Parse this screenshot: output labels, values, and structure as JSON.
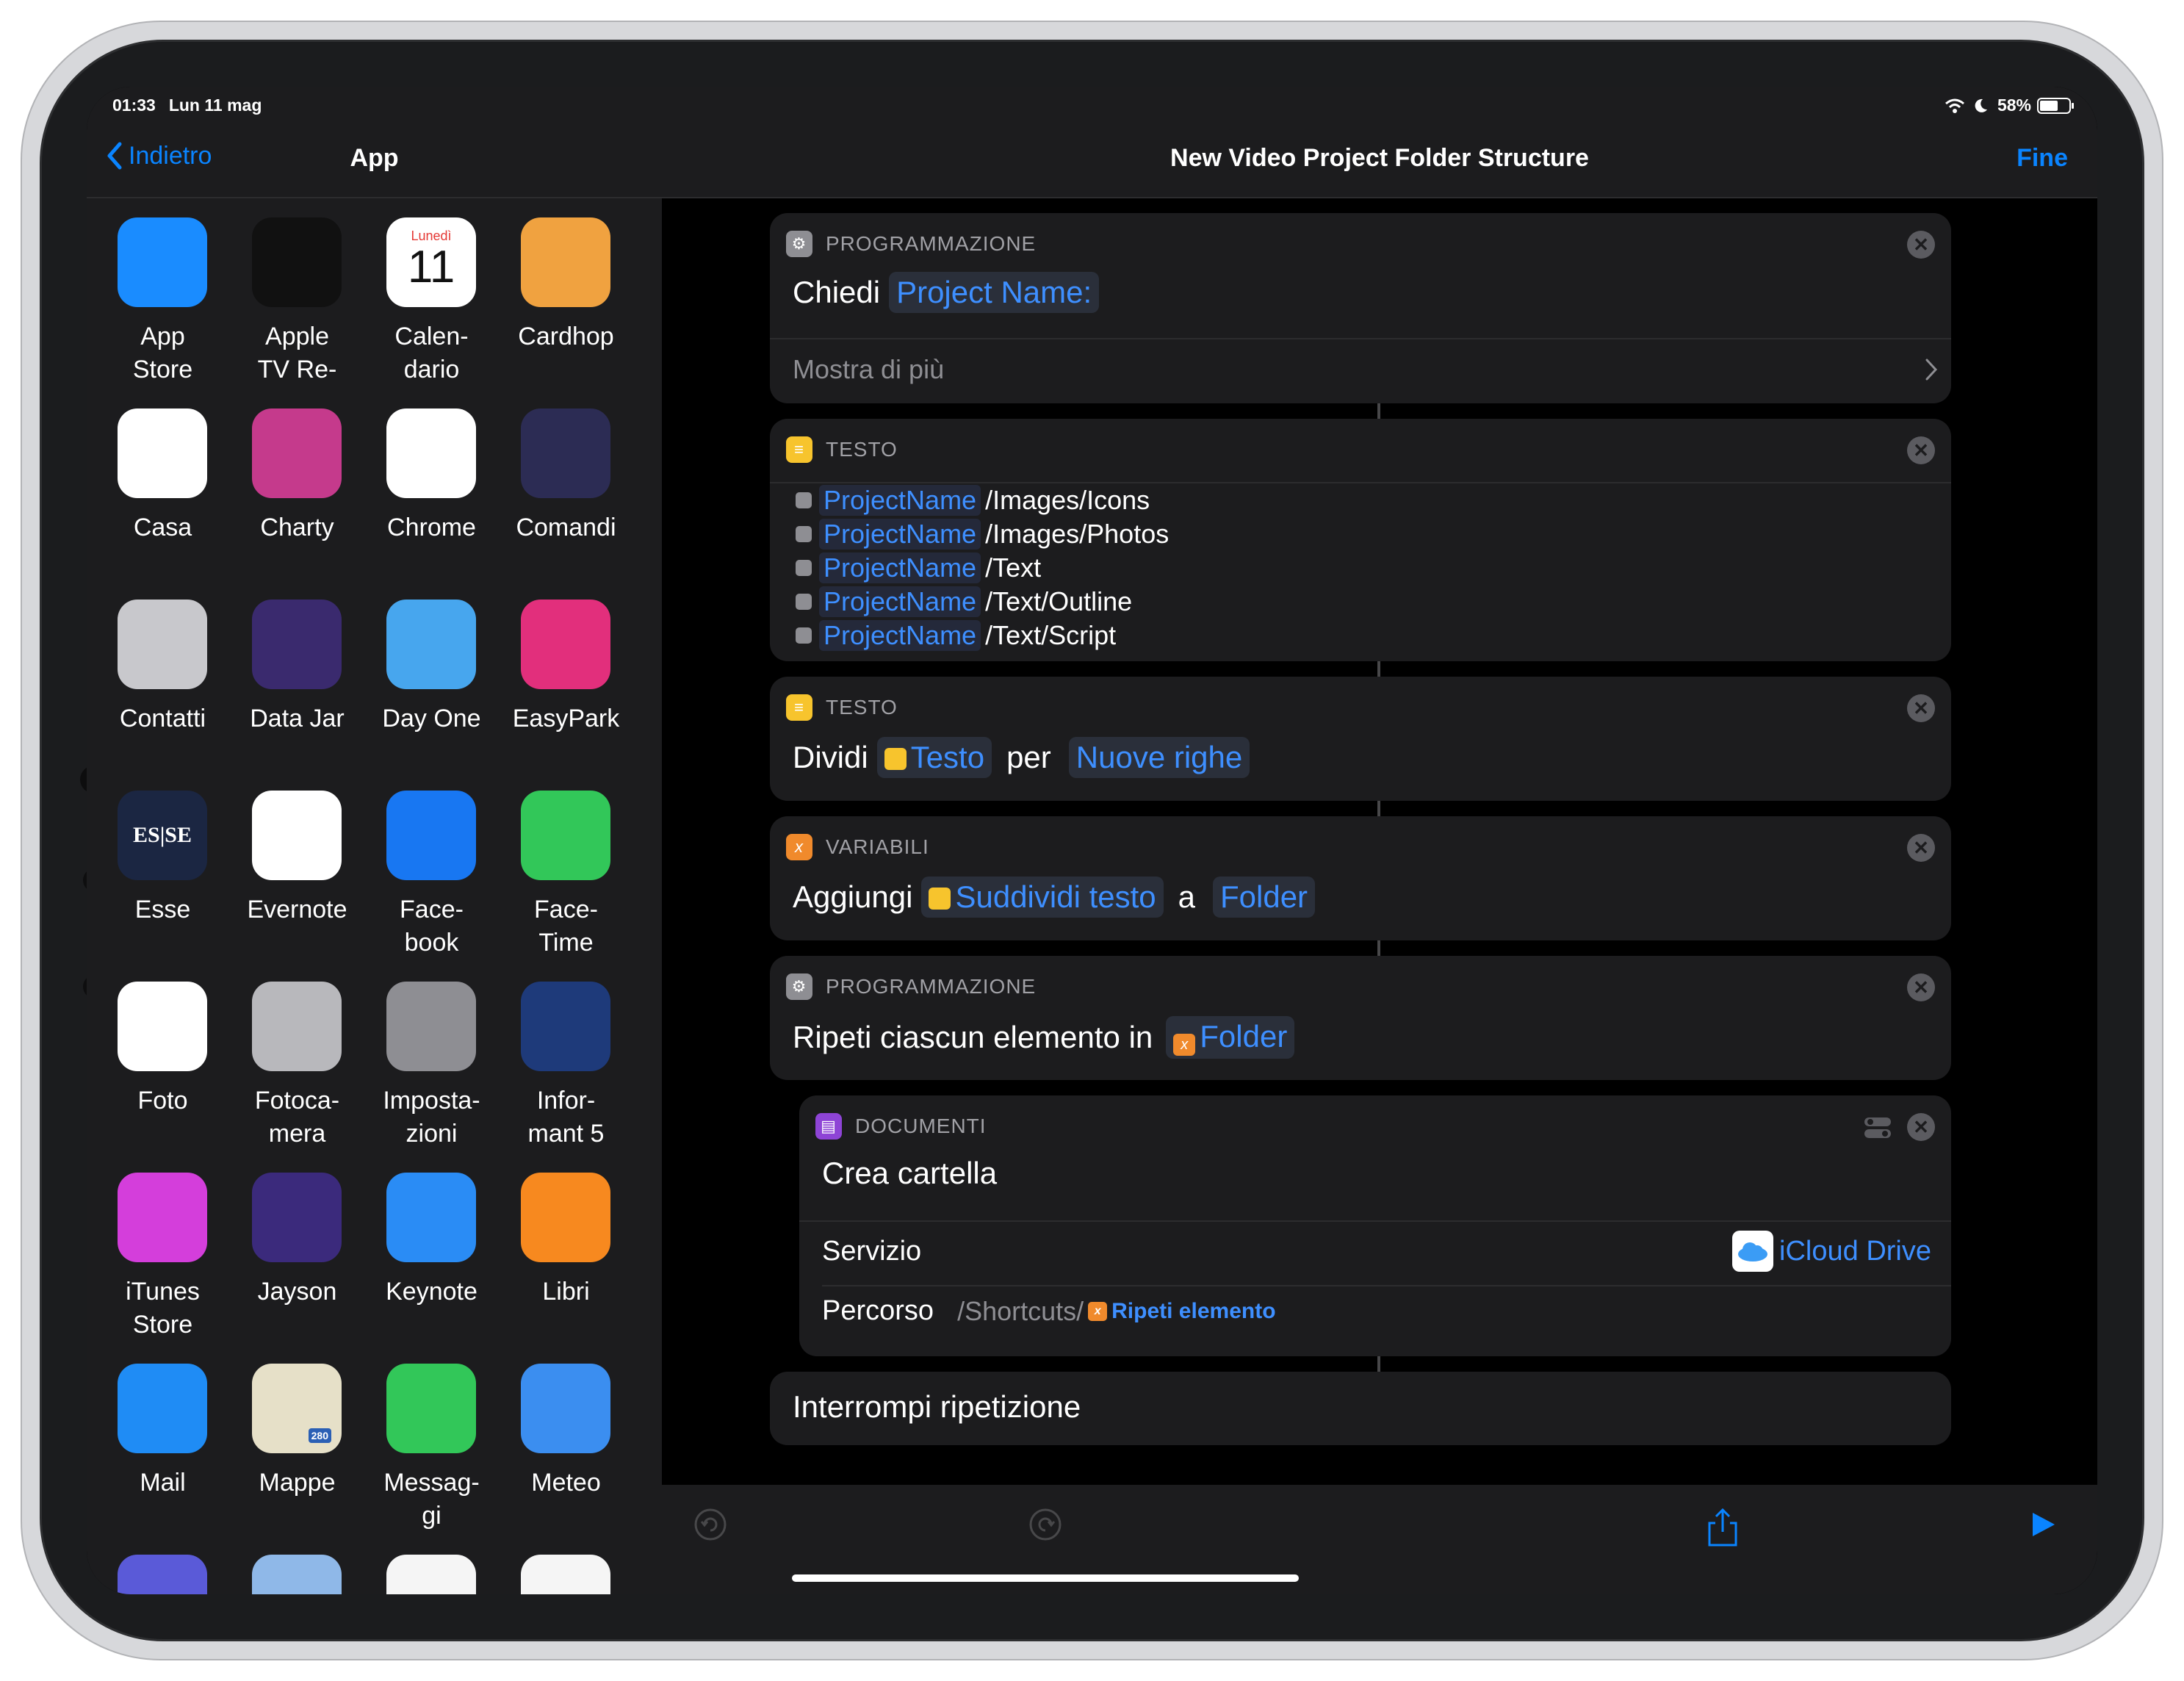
{
  "status": {
    "time": "01:33",
    "date": "Lun 11 mag",
    "battery": "58%"
  },
  "sidebar": {
    "back_label": "Indietro",
    "title": "App",
    "apps": [
      {
        "label": "App\nStore",
        "icon": "app-store-icon",
        "color": "#1a8cff"
      },
      {
        "label": "Apple\nTV Re-",
        "icon": "apple-tv-remote-icon",
        "color": "#111"
      },
      {
        "label": "Calen-\ndario",
        "icon": "calendar-icon",
        "color": "#fff",
        "day": "Lunedì",
        "num": "11"
      },
      {
        "label": "Cardhop",
        "icon": "cardhop-icon",
        "color": "#f0a240"
      },
      {
        "label": "Casa",
        "icon": "home-icon",
        "color": "#fff"
      },
      {
        "label": "Charty",
        "icon": "charty-icon",
        "color": "#c53a8c"
      },
      {
        "label": "Chrome",
        "icon": "chrome-icon",
        "color": "#fff"
      },
      {
        "label": "Comandi",
        "icon": "shortcuts-icon",
        "color": "#2c2c54"
      },
      {
        "label": "Contatti",
        "icon": "contacts-icon",
        "color": "#c8c8cc"
      },
      {
        "label": "Data Jar",
        "icon": "data-jar-icon",
        "color": "#3a2a6e"
      },
      {
        "label": "Day One",
        "icon": "day-one-icon",
        "color": "#47a6ee"
      },
      {
        "label": "EasyPark",
        "icon": "easypark-icon",
        "color": "#e22f7c"
      },
      {
        "label": "Esse",
        "icon": "esse-icon",
        "color": "#1b2642",
        "text": "ES|SE"
      },
      {
        "label": "Evernote",
        "icon": "evernote-icon",
        "color": "#fff"
      },
      {
        "label": "Face-\nbook",
        "icon": "facebook-icon",
        "color": "#1877f2"
      },
      {
        "label": "Face-\nTime",
        "icon": "facetime-icon",
        "color": "#32c759"
      },
      {
        "label": "Foto",
        "icon": "photos-icon",
        "color": "#fff"
      },
      {
        "label": "Fotoca-\nmera",
        "icon": "camera-icon",
        "color": "#b8b8bc"
      },
      {
        "label": "Imposta-\nzioni",
        "icon": "settings-icon",
        "color": "#8e8e93"
      },
      {
        "label": "Infor-\nmant 5",
        "icon": "informant-icon",
        "color": "#1e3a7a"
      },
      {
        "label": "iTunes\nStore",
        "icon": "itunes-store-icon",
        "color": "#d43edb"
      },
      {
        "label": "Jayson",
        "icon": "jayson-icon",
        "color": "#3b2a7c"
      },
      {
        "label": "Keynote",
        "icon": "keynote-icon",
        "color": "#2a8cf5"
      },
      {
        "label": "Libri",
        "icon": "books-icon",
        "color": "#f7891f"
      },
      {
        "label": "Mail",
        "icon": "mail-icon",
        "color": "#1f8cf5"
      },
      {
        "label": "Mappe",
        "icon": "maps-icon",
        "color": "#e6e0c8",
        "badge": "280"
      },
      {
        "label": "Messag-\ngi",
        "icon": "messages-icon",
        "color": "#32c759"
      },
      {
        "label": "Meteo",
        "icon": "weather-icon",
        "color": "#3b8ef0"
      },
      {
        "label": "",
        "icon": "app-icon",
        "color": "#5a5ad8"
      },
      {
        "label": "",
        "icon": "app-icon",
        "color": "#8fb8e8"
      },
      {
        "label": "",
        "icon": "music-icon",
        "color": "#f5f5f5"
      },
      {
        "label": "",
        "icon": "app-icon",
        "color": "#f5f5f5"
      }
    ]
  },
  "main": {
    "title": "New Video Project Folder Structure",
    "done": "Fine",
    "card1": {
      "category": "PROGRAMMAZIONE",
      "verb": "Chiedi",
      "param": "Project Name:",
      "more": "Mostra di più"
    },
    "card2": {
      "category": "TESTO",
      "lines": [
        {
          "token": "ProjectName",
          "text": "/Images/Icons"
        },
        {
          "token": "ProjectName",
          "text": "/Images/Photos"
        },
        {
          "token": "ProjectName",
          "text": "/Text"
        },
        {
          "token": "ProjectName",
          "text": "/Text/Outline"
        },
        {
          "token": "ProjectName",
          "text": "/Text/Script"
        }
      ]
    },
    "card3": {
      "category": "TESTO",
      "verb": "Dividi",
      "p1": "Testo",
      "mid": "per",
      "p2": "Nuove righe"
    },
    "card4": {
      "category": "VARIABILI",
      "verb": "Aggiungi",
      "p1": "Suddividi testo",
      "mid": "a",
      "p2": "Folder"
    },
    "card5": {
      "category": "PROGRAMMAZIONE",
      "verb": "Ripeti ciascun elemento in",
      "p1": "Folder"
    },
    "card6": {
      "category": "DOCUMENTI",
      "title": "Crea cartella",
      "service_label": "Servizio",
      "service_value": "iCloud Drive",
      "path_label": "Percorso",
      "path_prefix": "/Shortcuts/",
      "path_token": "Ripeti elemento"
    },
    "card7": {
      "title": "Interrompi ripetizione"
    }
  },
  "colors": {
    "accent": "#0a84ff",
    "card": "#1c1c1e",
    "bg": "#000000"
  }
}
